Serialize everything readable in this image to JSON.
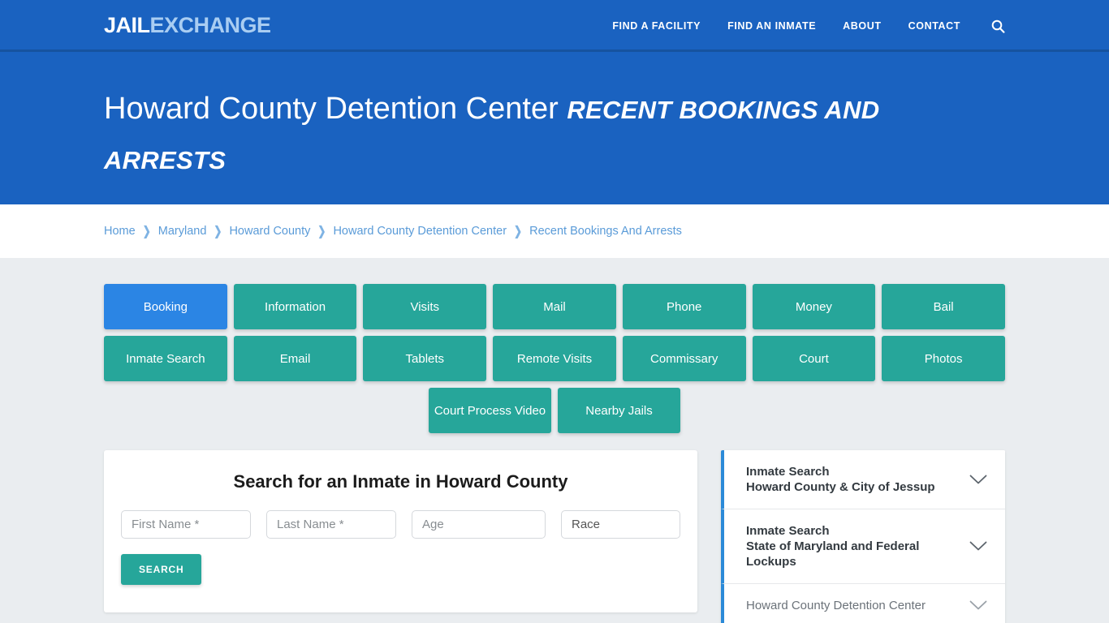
{
  "brand": {
    "logo_first": "JAIL",
    "logo_second": "EXCHANGE"
  },
  "nav": {
    "items": [
      {
        "label": "FIND A FACILITY"
      },
      {
        "label": "FIND AN INMATE"
      },
      {
        "label": "ABOUT"
      },
      {
        "label": "CONTACT"
      }
    ],
    "search_icon": "search-icon"
  },
  "hero": {
    "facility": "Howard County Detention Center",
    "subtitle": "Recent Bookings and Arrests"
  },
  "breadcrumb": {
    "separator": "❯",
    "items": [
      {
        "label": "Home"
      },
      {
        "label": "Maryland"
      },
      {
        "label": "Howard County"
      },
      {
        "label": "Howard County Detention Center"
      },
      {
        "label": "Recent Bookings And Arrests"
      }
    ]
  },
  "tabs": {
    "row1": [
      {
        "label": "Booking",
        "active": true
      },
      {
        "label": "Information",
        "active": false
      },
      {
        "label": "Visits",
        "active": false
      },
      {
        "label": "Mail",
        "active": false
      },
      {
        "label": "Phone",
        "active": false
      },
      {
        "label": "Money",
        "active": false
      },
      {
        "label": "Bail",
        "active": false
      }
    ],
    "row2": [
      {
        "label": "Inmate Search",
        "active": false
      },
      {
        "label": "Email",
        "active": false
      },
      {
        "label": "Tablets",
        "active": false
      },
      {
        "label": "Remote Visits",
        "active": false
      },
      {
        "label": "Commissary",
        "active": false
      },
      {
        "label": "Court",
        "active": false
      },
      {
        "label": "Photos",
        "active": false
      }
    ],
    "row3": [
      {
        "label": "Court Process Video",
        "active": false
      },
      {
        "label": "Nearby Jails",
        "active": false
      }
    ]
  },
  "search_form": {
    "heading": "Search for an Inmate in Howard County",
    "first_name_placeholder": "First Name *",
    "last_name_placeholder": "Last Name *",
    "age_placeholder": "Age",
    "race_selected": "Race",
    "race_options": [
      "Race"
    ],
    "submit_label": "SEARCH"
  },
  "sidebar": {
    "items": [
      {
        "line1": "Inmate Search",
        "line2": "Howard County & City of Jessup",
        "line3": "",
        "muted": false,
        "icon": "chevron-down-icon"
      },
      {
        "line1": "Inmate Search",
        "line2": "State of Maryland and Federal",
        "line3": "Lockups",
        "muted": false,
        "icon": "chevron-down-icon"
      },
      {
        "line1": "Howard County Detention Center",
        "line2": "",
        "line3": "",
        "muted": true,
        "icon": "chevron-down-icon"
      }
    ]
  },
  "colors": {
    "brand_blue": "#1a62c0",
    "accent_teal": "#26a69a",
    "active_blue": "#2b85e4",
    "page_bg": "#eaedf0",
    "accordion_bar": "#2b8ad8",
    "link_blue": "#5a9bd8"
  }
}
